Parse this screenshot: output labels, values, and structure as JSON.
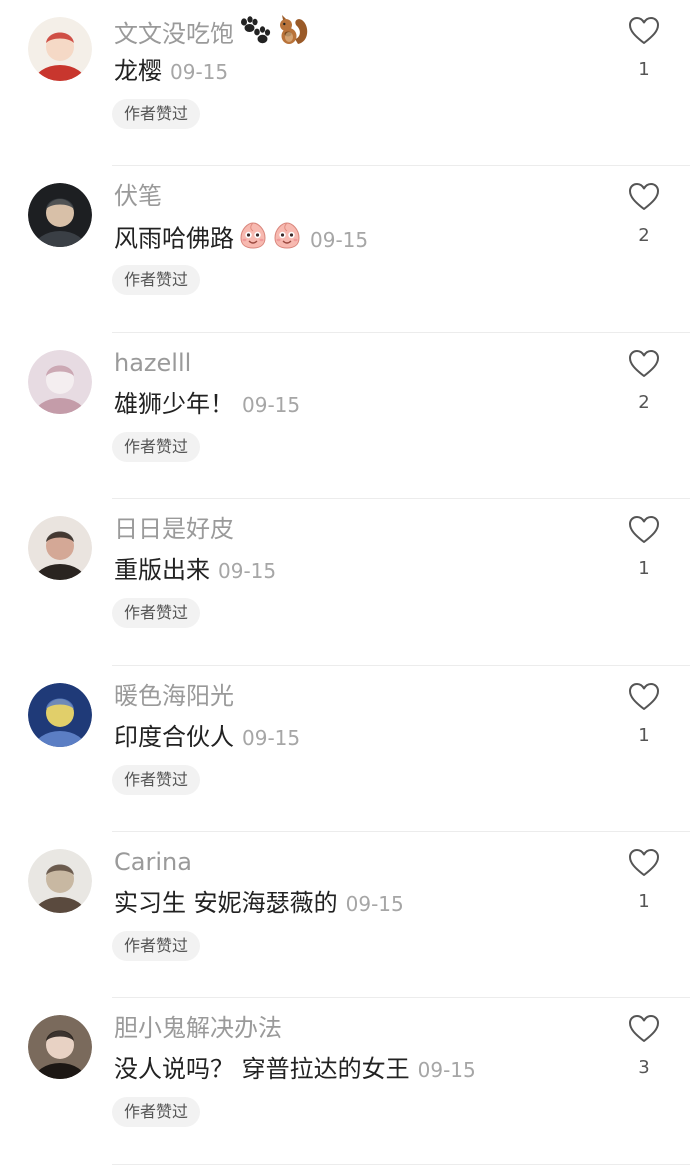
{
  "comments": [
    {
      "username": "文文没吃饱",
      "text": "龙樱",
      "time": "09-15",
      "badge": "作者赞过",
      "likes": "1",
      "username_emoji": [
        "paw-prints-icon",
        "squirrel-icon"
      ],
      "text_emoji": [],
      "avatar_colors": [
        "#f4efe8",
        "#c8362e",
        "#f5d9c6"
      ]
    },
    {
      "username": "伏笔",
      "text": "风雨哈佛路",
      "time": "09-15",
      "badge": "作者赞过",
      "likes": "2",
      "username_emoji": [],
      "text_emoji": [
        "peach-face-icon",
        "peach-face-icon"
      ],
      "avatar_colors": [
        "#1d1f22",
        "#3a3f45",
        "#d8c0a8"
      ]
    },
    {
      "username": "hazelll",
      "text": "雄狮少年！",
      "time": "09-15",
      "badge": "作者赞过",
      "likes": "2",
      "username_emoji": [],
      "text_emoji": [],
      "avatar_colors": [
        "#e7dbe2",
        "#c49ca9",
        "#f4eef0"
      ]
    },
    {
      "username": "日日是好皮",
      "text": "重版出来",
      "time": "09-15",
      "badge": "作者赞过",
      "likes": "1",
      "username_emoji": [],
      "text_emoji": [],
      "avatar_colors": [
        "#eae4df",
        "#2a2420",
        "#d4a896"
      ]
    },
    {
      "username": "暖色海阳光",
      "text": "印度合伙人",
      "time": "09-15",
      "badge": "作者赞过",
      "likes": "1",
      "username_emoji": [],
      "text_emoji": [],
      "avatar_colors": [
        "#1f3a78",
        "#5b7ec4",
        "#e1cf6a"
      ]
    },
    {
      "username": "Carina",
      "text": "实习生 安妮海瑟薇的",
      "time": "09-15",
      "badge": "作者赞过",
      "likes": "1",
      "username_emoji": [],
      "text_emoji": [],
      "avatar_colors": [
        "#e9e7e3",
        "#5a4a3e",
        "#c8b8a2"
      ]
    },
    {
      "username": "胆小鬼解决办法",
      "text": "没人说吗？ 穿普拉达的女王",
      "time": "09-15",
      "badge": "作者赞过",
      "likes": "3",
      "username_emoji": [],
      "text_emoji": [],
      "avatar_colors": [
        "#7a6a5c",
        "#1c1714",
        "#e8d2c4"
      ]
    }
  ],
  "colors": {
    "username": "#9a9a9a",
    "text": "#222222",
    "time": "#a6a6a6",
    "badge_bg": "#f2f2f2",
    "heart": "#555555",
    "divider": "#ececec"
  }
}
